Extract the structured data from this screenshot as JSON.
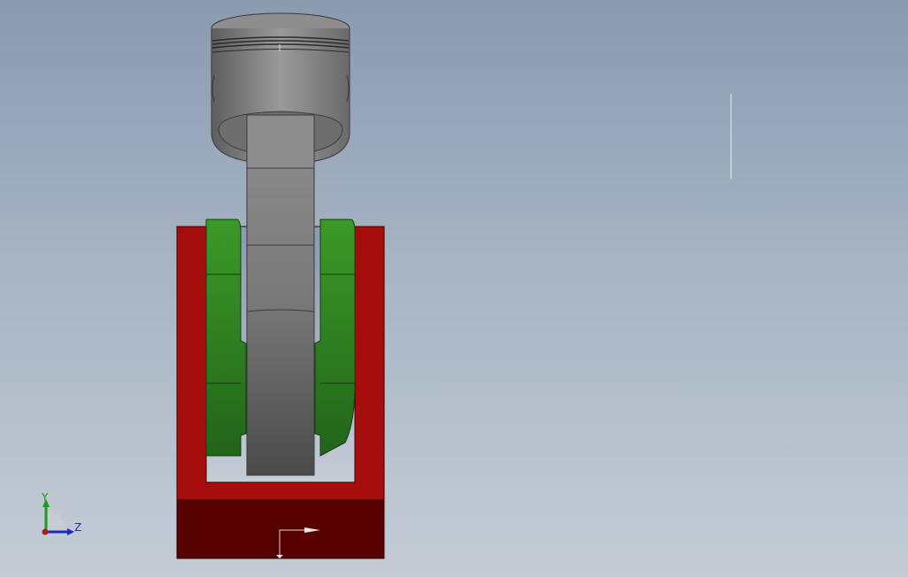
{
  "window": {
    "kind": "cad-3d-viewport"
  },
  "scene": {
    "model": "piston-connecting-rod-crankshaft-assembly",
    "colors": {
      "background_top": "#8a9bb0",
      "background_bottom": "#c5ccd6",
      "piston": "#7d7d7d",
      "connecting_rod": "#8a8a8a",
      "crank_web": "#3a8f26",
      "frame": "#a50d0d",
      "base": "#560000"
    }
  },
  "triad": {
    "y_label": "Y",
    "z_label": "Z",
    "colors": {
      "y_axis": "#1d9a1d",
      "z_axis": "#1a2fb0",
      "x_axis": "#b01a1a"
    }
  }
}
